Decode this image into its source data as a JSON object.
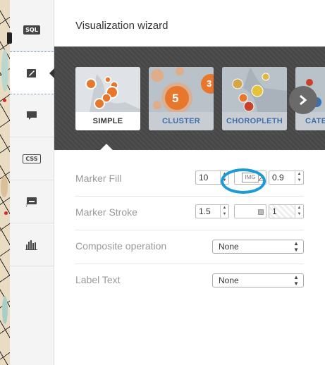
{
  "toolbar": {
    "items": [
      {
        "name": "sql-tab",
        "text": "SQL"
      },
      {
        "name": "wizard-tab",
        "text": ""
      },
      {
        "name": "infowindow-tab",
        "text": ""
      },
      {
        "name": "css-tab",
        "text": "CSS"
      },
      {
        "name": "legends-tab",
        "text": ""
      },
      {
        "name": "filters-tab",
        "text": ""
      }
    ]
  },
  "panel": {
    "title": "Visualization wizard",
    "styles": [
      {
        "label": "SIMPLE",
        "selected": true
      },
      {
        "label": "CLUSTER",
        "selected": false,
        "thumb_number": "5",
        "thumb_number_2": "3"
      },
      {
        "label": "CHOROPLETH",
        "selected": false
      },
      {
        "label": "CATE",
        "selected": false
      }
    ],
    "next_icon": "chevron-right-icon"
  },
  "properties": {
    "marker_fill": {
      "label": "Marker Fill",
      "size": "10",
      "image_placeholder": "IMG",
      "opacity": "0.9"
    },
    "marker_stroke": {
      "label": "Marker Stroke",
      "width": "1.5",
      "opacity": "1"
    },
    "composite_operation": {
      "label": "Composite operation",
      "value": "None"
    },
    "label_text": {
      "label": "Label Text",
      "value": "None"
    }
  },
  "colors": {
    "accent_marker": "#e8772e",
    "highlight": "#1a9ad6",
    "carousel_bg": "#4a4a4a"
  }
}
